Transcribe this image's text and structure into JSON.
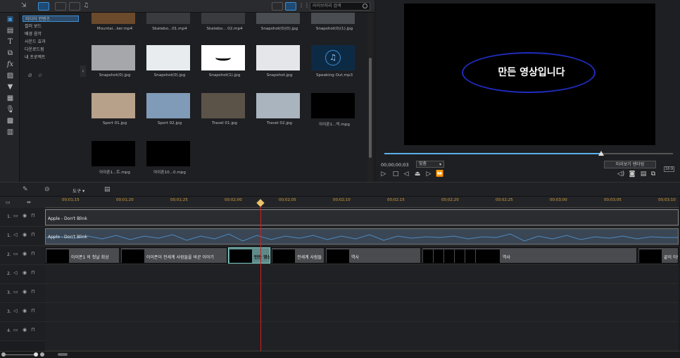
{
  "library": {
    "search_placeholder": "라이브러리 검색",
    "categories": [
      "미디어 컨텐츠",
      "컬러 보드",
      "배경 음악",
      "사운드 효과",
      "다운로드됨",
      "내 프로젝트"
    ],
    "media": [
      {
        "caption": "Mountai...ker.mp4",
        "color": "#6b4a2c"
      },
      {
        "caption": "Skatebo...01.mp4",
        "color": "#3a3b3f"
      },
      {
        "caption": "Skatebo... 02.mp4",
        "color": "#3a3b3f"
      },
      {
        "caption": "Snapshot(0)(0).jpg",
        "color": "#4a4d52"
      },
      {
        "caption": "Snapshot(0)(1).jpg",
        "color": "#4a4d52"
      },
      {
        "caption": "Snapshot(0).jpg",
        "color": "#a5a7ab"
      },
      {
        "caption": "Snapshot(0).jpg",
        "color": "#e8ecef"
      },
      {
        "caption": "Snapshot(1).jpg",
        "color": "#ffffff"
      },
      {
        "caption": "Snapshot.jpg",
        "color": "#e4e6ea"
      },
      {
        "caption": "Speaking Out.mp3",
        "color": "#0d2a45"
      },
      {
        "caption": "Sport 01.jpg",
        "color": "#b7a18a"
      },
      {
        "caption": "Sport 02.jpg",
        "color": "#7f9bb8"
      },
      {
        "caption": "Travel 01.jpg",
        "color": "#5b5248"
      },
      {
        "caption": "Travel 02.jpg",
        "color": "#a9b4bf"
      },
      {
        "caption": "아이폰1...억.mpg",
        "color": "#000000"
      },
      {
        "caption": "아이폰1...트.mpg",
        "color": "#000000"
      },
      {
        "caption": "아이폰10...0.mpg",
        "color": "#000000"
      }
    ]
  },
  "preview": {
    "overlay_text": "만든 영상입니다",
    "timecode": "00;00;00;03",
    "fit": "맞춤",
    "render_button": "미리보기 렌더링",
    "progress": 0.75
  },
  "timeline": {
    "tool_label": "도구",
    "ticks": [
      "00;01;15",
      "00;01;20",
      "00;01;25",
      "00;02;00",
      "00;02;05",
      "00;02;10",
      "00;02;15",
      "00;02;20",
      "00;02;25",
      "00;03;00",
      "00;03;05",
      "00;03;10"
    ],
    "tracks": [
      {
        "num": "1."
      },
      {
        "num": "1."
      },
      {
        "num": "2."
      },
      {
        "num": "2."
      },
      {
        "num": "3."
      },
      {
        "num": "3."
      },
      {
        "num": "4."
      }
    ],
    "clips": {
      "title_1": "Apple - Don't Blink",
      "audio_1": "Apple - Don't Blink",
      "v2_a": "아이폰1 의 첫날 회상",
      "v2_b": "아이폰이 전세계 사람들을 바꾼 이야기",
      "v2_c": "만든 영상",
      "v2_d": "전세계 사람들",
      "v2_e": "역사",
      "v2_f": "역사",
      "v2_g": "끝이 아닌"
    }
  }
}
